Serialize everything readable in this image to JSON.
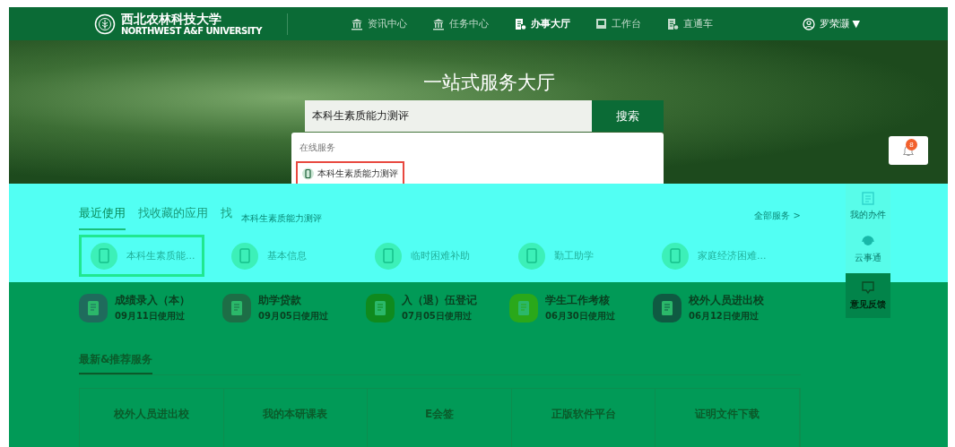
{
  "nav": {
    "logo_cn": "西北农林科技大学",
    "logo_en": "NORTHWEST A&F UNIVERSITY",
    "items": [
      {
        "label": "资讯中心",
        "kind": "bank",
        "selected": false
      },
      {
        "label": "任务中心",
        "kind": "bank",
        "selected": false
      },
      {
        "label": "办事大厅",
        "kind": "doc",
        "selected": true
      },
      {
        "label": "工作台",
        "kind": "board",
        "selected": false
      },
      {
        "label": "直通车",
        "kind": "doc",
        "selected": false
      }
    ],
    "user": "罗荣灏",
    "user_caret": "▼"
  },
  "hero": {
    "title": "一站式服务大厅",
    "search": {
      "value": "本科生素质能力测评",
      "button": "搜索"
    },
    "dropdown": {
      "heading": "在线服务",
      "items": [
        {
          "label": "本科生素质能力测评",
          "highlighted": true
        }
      ]
    }
  },
  "notifications": {
    "count": "8"
  },
  "recent": {
    "tabs": [
      {
        "label": "最近使用",
        "selected": true
      },
      {
        "label": "找收藏的应用",
        "selected": false
      },
      {
        "label": "找",
        "selected": false
      }
    ],
    "hint": "本科生素质能力测评",
    "all_link": "全部服务 >",
    "apps": [
      {
        "name": "本科生素质能...",
        "highlighted": true
      },
      {
        "name": "基本信息",
        "highlighted": false
      },
      {
        "name": "临时困难补助",
        "highlighted": false
      },
      {
        "name": "勤工助学",
        "highlighted": false
      },
      {
        "name": "家庭经济困难...",
        "highlighted": false
      }
    ]
  },
  "sidebar_upper": [
    {
      "label": "我的办件",
      "kind": "doc"
    },
    {
      "label": "云事通",
      "kind": "person"
    }
  ],
  "sidebar_lower": [
    {
      "label": "意见反馈",
      "kind": "chat"
    }
  ],
  "frequent": [
    {
      "name": "成绩录入（本）",
      "date": "09月11日使用过",
      "color": "#1f6b5c"
    },
    {
      "name": "助学贷款",
      "date": "09月05日使用过",
      "color": "#1d6e46"
    },
    {
      "name": "入（退）伍登记",
      "date": "07月05日使用过",
      "color": "#0f8a1e"
    },
    {
      "name": "学生工作考核",
      "date": "06月30日使用过",
      "color": "#2aa81a"
    },
    {
      "name": "校外人员进出校",
      "date": "06月12日使用过",
      "color": "#0f5a42"
    }
  ],
  "recommended": {
    "title": "最新&推荐服务",
    "cards": [
      "校外人员进出校",
      "我的本研课表",
      "E会签",
      "正版软件平台",
      "证明文件下载"
    ]
  }
}
